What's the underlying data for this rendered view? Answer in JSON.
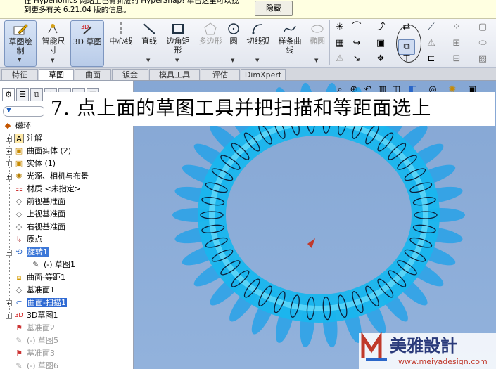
{
  "notification": {
    "text_line1": "在 Hyperionics 网站上已有新版的 HyperSnap! 单击这里可以找",
    "text_line2": "到更多有关 6.21.04 版的信息。",
    "hide_button": "隐藏"
  },
  "toolbar": {
    "buttons": [
      {
        "label": "草图绘\n制"
      },
      {
        "label": "智能尺\n寸"
      },
      {
        "label": "3D 草图"
      },
      {
        "label": "中心线"
      },
      {
        "label": "直线"
      },
      {
        "label": "边角矩\n形"
      },
      {
        "label": "多边形"
      },
      {
        "label": "圆"
      },
      {
        "label": "切线弧"
      },
      {
        "label": "样条曲\n线"
      },
      {
        "label": "椭圆"
      }
    ]
  },
  "tabs": [
    "特征",
    "草图",
    "曲面",
    "钣金",
    "模具工具",
    "评估",
    "DimXpert"
  ],
  "selected_tab": "草图",
  "caption": "7. 点上面的草图工具并把扫描和等距面选上",
  "tree": {
    "root": "磁环",
    "items": [
      {
        "label": "注解"
      },
      {
        "label": "曲面实体 (2)"
      },
      {
        "label": "实体 (1)"
      },
      {
        "label": "光源、相机与布景"
      },
      {
        "label": "材质 <未指定>"
      },
      {
        "label": "前视基准面"
      },
      {
        "label": "上视基准面"
      },
      {
        "label": "右视基准面"
      },
      {
        "label": "原点"
      },
      {
        "label": "旋转1"
      },
      {
        "label": "(-) 草图1"
      },
      {
        "label": "曲面-等距1"
      },
      {
        "label": "基准面1"
      },
      {
        "label": "曲面-扫描1"
      },
      {
        "label": "3D草图1"
      },
      {
        "label": "基准面2"
      },
      {
        "label": "(-) 草图5"
      },
      {
        "label": "基准面3"
      },
      {
        "label": "(-) 草图6"
      }
    ]
  },
  "watermark": {
    "brand": "美雅設計",
    "url": "www.meiyadesign.com"
  },
  "colors": {
    "viewport_bg": "#8aaad6",
    "tree_highlight": "#2f6ad3",
    "ring": "#14c8f0"
  }
}
